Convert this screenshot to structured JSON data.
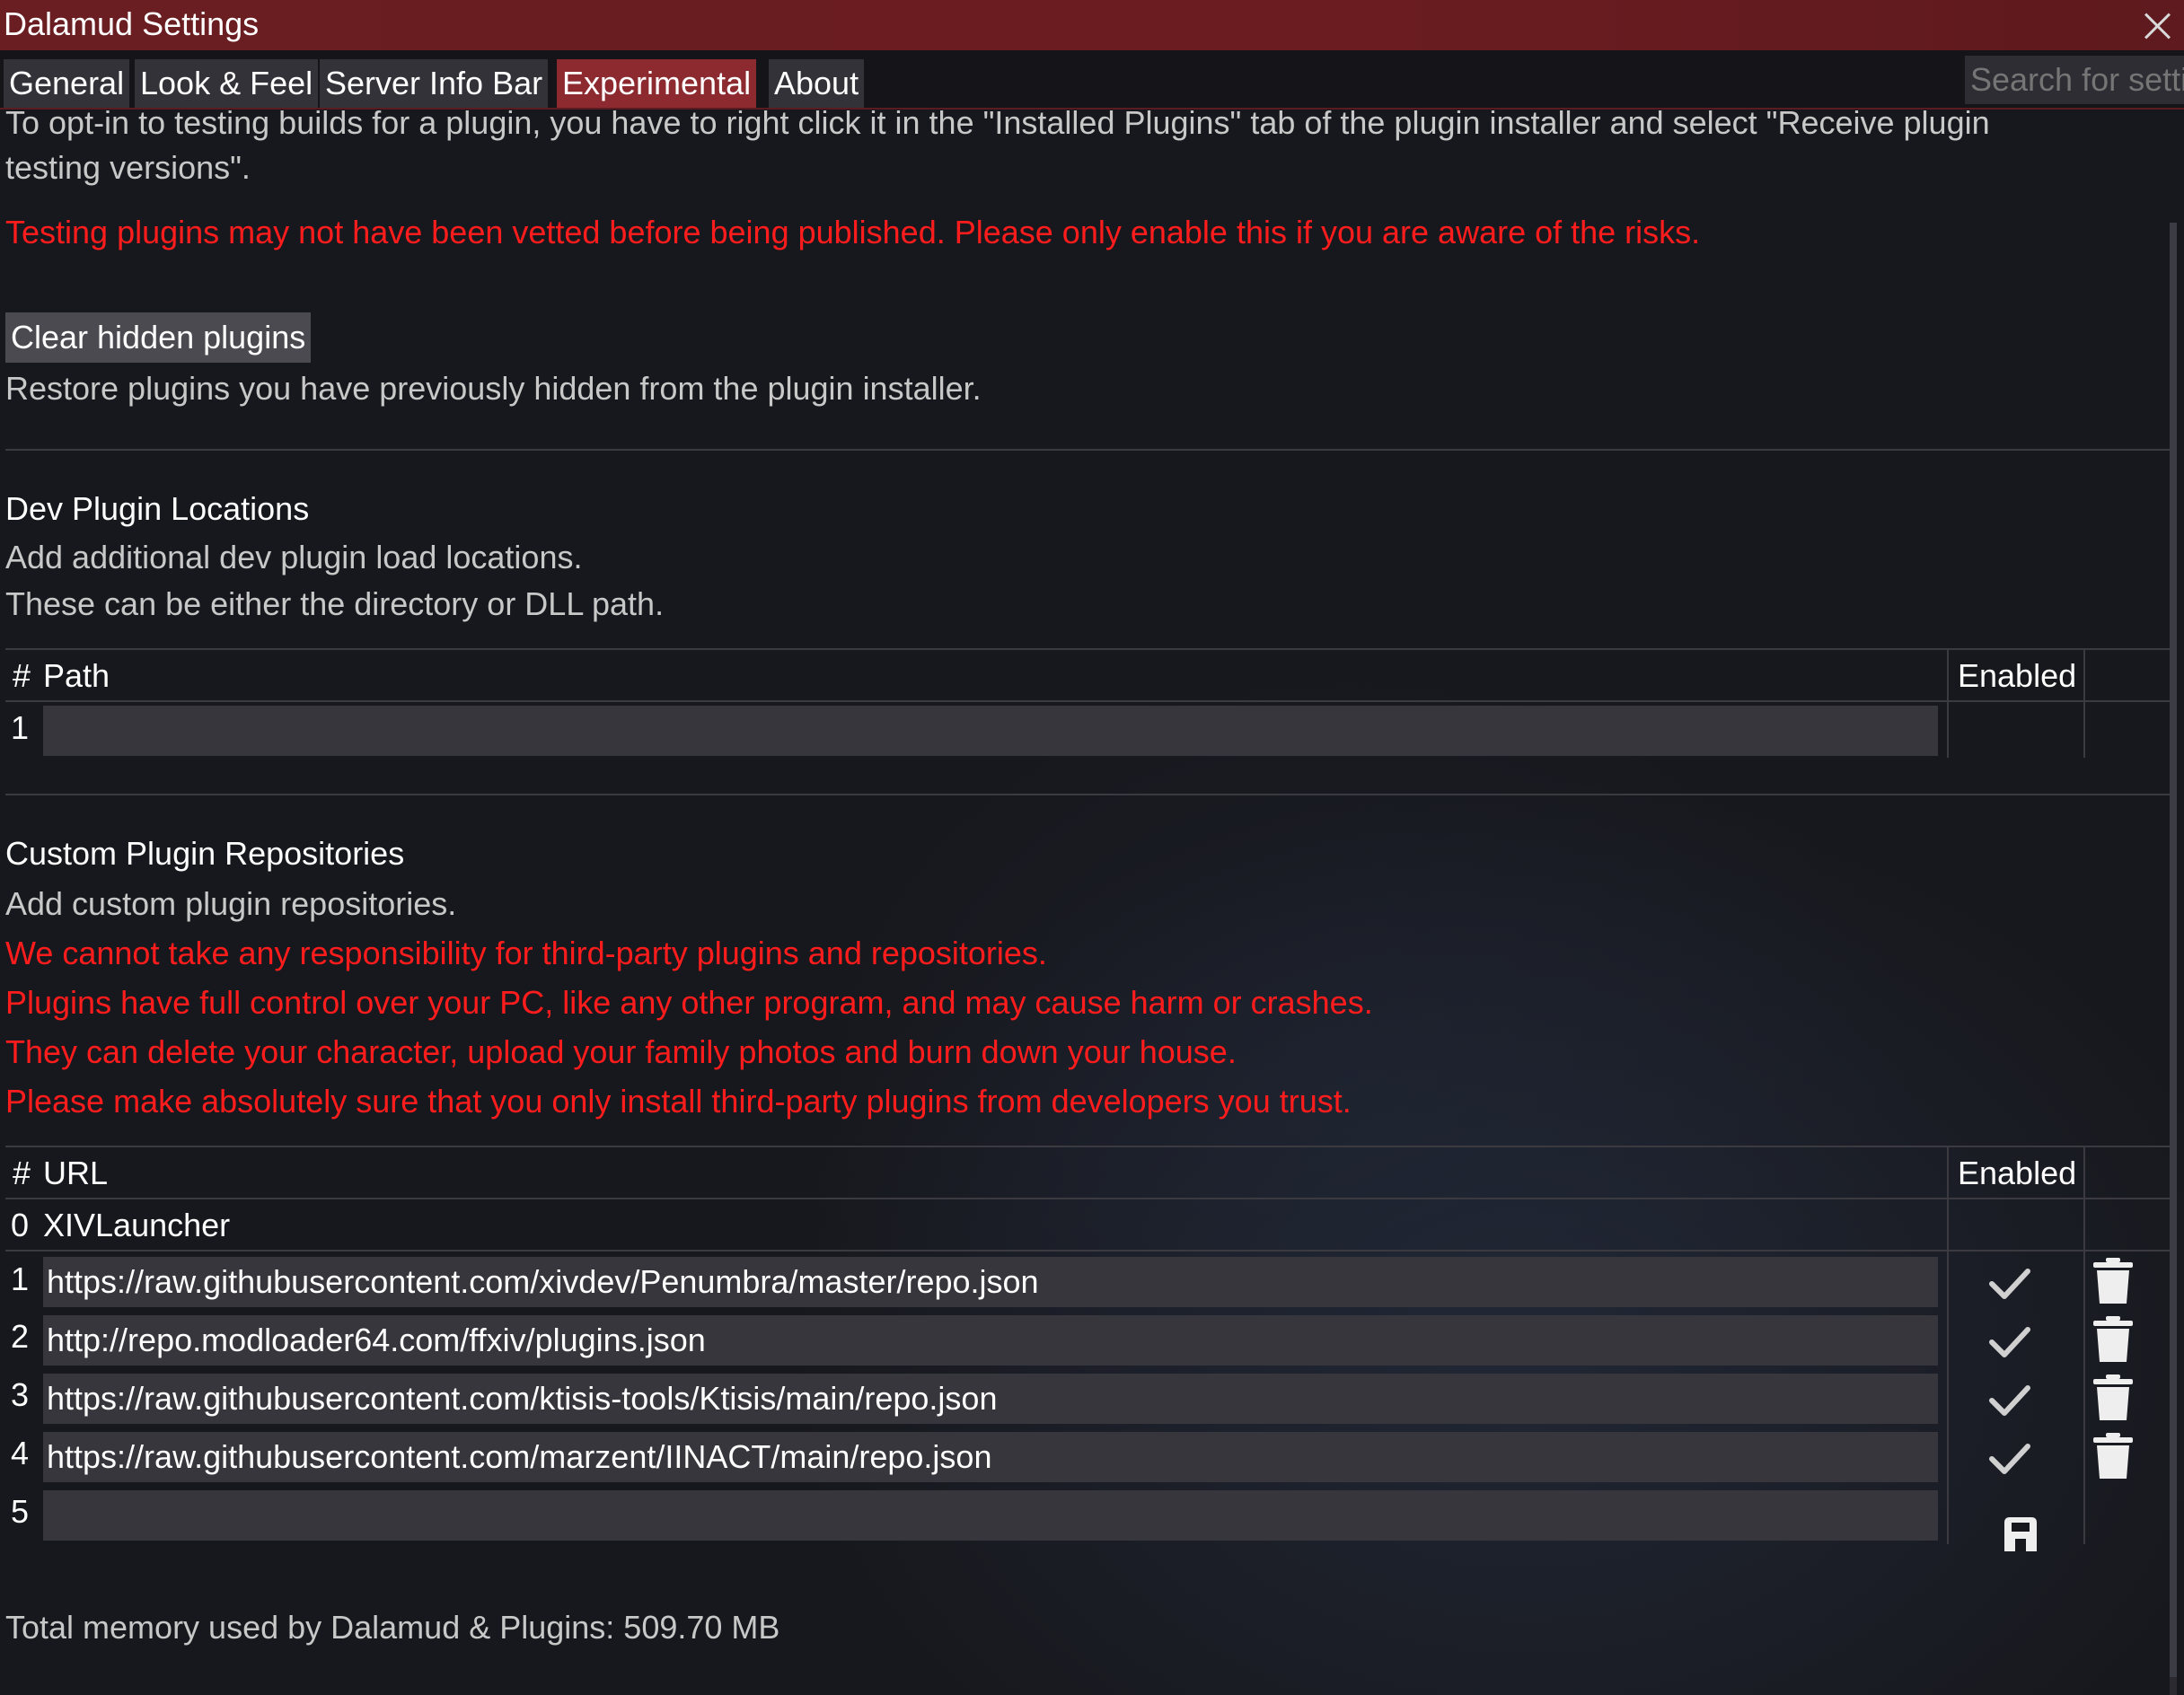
{
  "window": {
    "title": "Dalamud Settings"
  },
  "tabs": [
    {
      "label": "General"
    },
    {
      "label": "Look & Feel"
    },
    {
      "label": "Server Info Bar"
    },
    {
      "label": "Experimental",
      "active": true
    },
    {
      "label": "About"
    }
  ],
  "search": {
    "placeholder": "Search for settings"
  },
  "testing": {
    "info_line1": "To opt-in to testing builds for a plugin, you have to right click it in the \"Installed Plugins\" tab of the plugin installer and select \"Receive plugin",
    "info_line2": "testing versions\".",
    "warning": "Testing plugins may not have been vetted before being published. Please only enable this if you are aware of the risks."
  },
  "clear_hidden": {
    "button_label": "Clear hidden plugins",
    "description": "Restore plugins you have previously hidden from the plugin installer."
  },
  "dev_plugins": {
    "heading": "Dev Plugin Locations",
    "desc_line1": "Add additional dev plugin load locations.",
    "desc_line2": "These can be either the directory or DLL path.",
    "col_num": "#",
    "col_path": "Path",
    "col_enabled": "Enabled",
    "rows": [
      {
        "num": "1",
        "value": ""
      }
    ]
  },
  "custom_repos": {
    "heading": "Custom Plugin Repositories",
    "desc": "Add custom plugin repositories.",
    "warning1": "We cannot take any responsibility for third-party plugins and repositories.",
    "warning2": "Plugins have full control over your PC, like any other program, and may cause harm or crashes.",
    "warning3": "They can delete your character, upload your family photos and burn down your house.",
    "warning4": "Please make absolutely sure that you only install third-party plugins from developers you trust.",
    "col_num": "#",
    "col_url": "URL",
    "col_enabled": "Enabled",
    "builtin": {
      "num": "0",
      "name": "XIVLauncher"
    },
    "rows": [
      {
        "num": "1",
        "url": "https://raw.githubusercontent.com/xivdev/Penumbra/master/repo.json",
        "enabled": true
      },
      {
        "num": "2",
        "url": "http://repo.modloader64.com/ffxiv/plugins.json",
        "enabled": true
      },
      {
        "num": "3",
        "url": "https://raw.githubusercontent.com/ktisis-tools/Ktisis/main/repo.json",
        "enabled": true
      },
      {
        "num": "4",
        "url": "https://raw.githubusercontent.com/marzent/IINACT/main/repo.json",
        "enabled": true
      }
    ],
    "new_row": {
      "num": "5",
      "value": ""
    }
  },
  "footer": {
    "memory": "Total memory used by Dalamud & Plugins: 509.70 MB"
  },
  "colors": {
    "accent": "#8c2a2f",
    "warning": "#ff1c1c",
    "titlebar": "#6a1e22"
  }
}
